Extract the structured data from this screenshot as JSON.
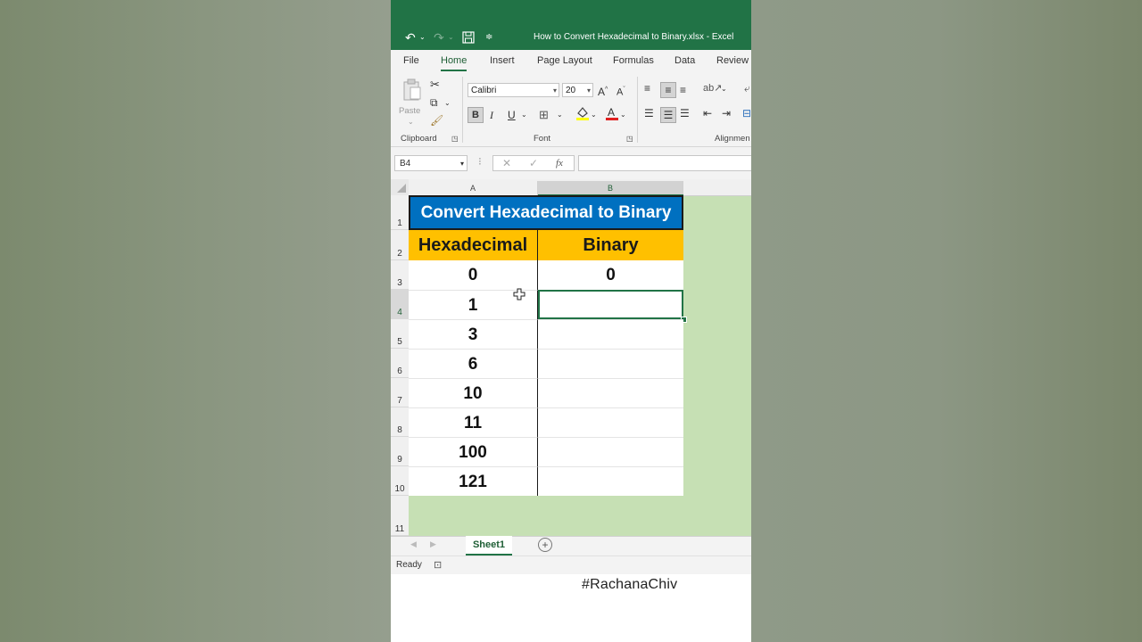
{
  "window": {
    "title": "How to Convert Hexadecimal to Binary.xlsx  -  Excel"
  },
  "ribbon_tabs": [
    "File",
    "Home",
    "Insert",
    "Page Layout",
    "Formulas",
    "Data",
    "Review"
  ],
  "ribbon": {
    "clipboard_label": "Clipboard",
    "paste_label": "Paste",
    "font_label": "Font",
    "alignment_label": "Alignmen",
    "font_name": "Calibri",
    "font_size": "20",
    "bold": "B",
    "italic": "I",
    "underline": "U"
  },
  "formula_bar": {
    "name_box": "B4",
    "fx": "fx"
  },
  "columns": [
    "A",
    "B"
  ],
  "rows": [
    "1",
    "2",
    "3",
    "4",
    "5",
    "6",
    "7",
    "8",
    "9",
    "10",
    "11"
  ],
  "table": {
    "title": "Convert Hexadecimal to Binary",
    "headers": [
      "Hexadecimal",
      "Binary"
    ],
    "hex_values": [
      "0",
      "1",
      "3",
      "6",
      "10",
      "11",
      "100",
      "121"
    ],
    "binary_values": [
      "0",
      "",
      "",
      "",
      "",
      "",
      "",
      ""
    ]
  },
  "sheet_tab": "Sheet1",
  "status": "Ready",
  "hashtag": "#RachanaChiv",
  "colors": {
    "excel_green": "#217346",
    "title_blue": "#0070c0",
    "header_orange": "#ffc000",
    "empty_area": "#c6e0b4"
  }
}
